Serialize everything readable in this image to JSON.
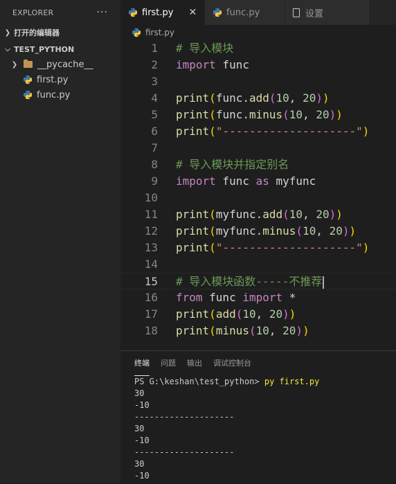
{
  "sidebar": {
    "header": "EXPLORER",
    "more": "···",
    "open_editors": "打开的编辑器",
    "project": "TEST_PYTHON",
    "tree": [
      {
        "name": "__pycache__",
        "type": "folder"
      },
      {
        "name": "first.py",
        "type": "python"
      },
      {
        "name": "func.py",
        "type": "python"
      }
    ]
  },
  "tabs": [
    {
      "label": "first.py",
      "active": true,
      "close": "✕"
    },
    {
      "label": "func.py",
      "active": false
    },
    {
      "label": "设置",
      "active": false
    }
  ],
  "breadcrumb": {
    "file": "first.py"
  },
  "editor": {
    "current_line": 15,
    "lines": [
      {
        "n": "1"
      },
      {
        "n": "2"
      },
      {
        "n": "3"
      },
      {
        "n": "4"
      },
      {
        "n": "5"
      },
      {
        "n": "6"
      },
      {
        "n": "7"
      },
      {
        "n": "8"
      },
      {
        "n": "9"
      },
      {
        "n": "10"
      },
      {
        "n": "11"
      },
      {
        "n": "12"
      },
      {
        "n": "13"
      },
      {
        "n": "14"
      },
      {
        "n": "15"
      },
      {
        "n": "16"
      },
      {
        "n": "17"
      },
      {
        "n": "18"
      }
    ],
    "comment1": "# 导入模块",
    "comment2": "# 导入模块并指定别名",
    "comment3": "# 导入模块函数-----不推荐",
    "dashes": "\"--------------------\""
  },
  "panel": {
    "tabs": [
      "终端",
      "问题",
      "输出",
      "调试控制台"
    ],
    "prompt": "PS G:\\keshan\\test_python> ",
    "command": "py first.py",
    "output": [
      "30",
      "-10",
      "--------------------",
      "30",
      "-10",
      "--------------------",
      "30",
      "-10"
    ]
  },
  "colors": {
    "accent": "#007acc",
    "comment": "#6a9955",
    "keyword": "#569cd6",
    "function": "#dcdcaa",
    "number": "#b5cea8",
    "string": "#ce9178"
  },
  "icons": {
    "python": "python-icon",
    "folder": "folder-icon",
    "settings": "settings-doc-icon",
    "close": "close-icon"
  }
}
